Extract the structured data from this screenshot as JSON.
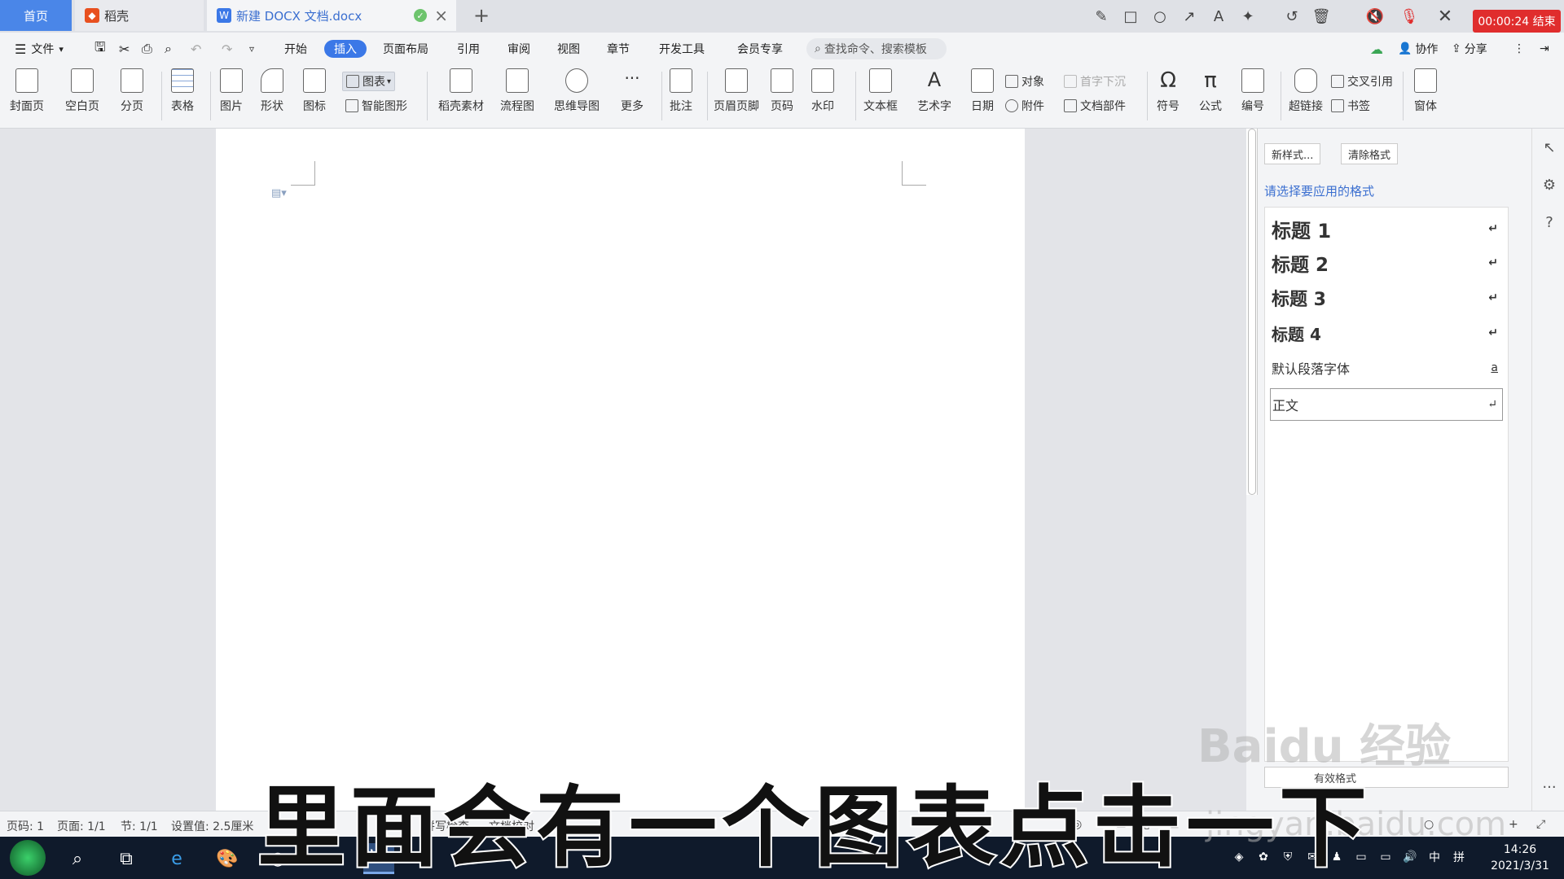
{
  "tabs": {
    "home": "首页",
    "daoke": "稻壳",
    "document": "新建 DOCX 文档.docx",
    "add": "+"
  },
  "recording": {
    "badge": "00:00:24 结束"
  },
  "menu": {
    "file": "文件",
    "items": [
      "开始",
      "插入",
      "页面布局",
      "引用",
      "审阅",
      "视图",
      "章节",
      "开发工具",
      "会员专享"
    ],
    "active": "插入",
    "search_placeholder": "查找命令、搜索模板",
    "collaborate": "协作",
    "share": "分享"
  },
  "ribbon": {
    "cover": "封面页",
    "blank": "空白页",
    "pagebreak": "分页",
    "table": "表格",
    "picture": "图片",
    "shape": "形状",
    "icon": "图标",
    "chart": "图表",
    "smartart": "智能图形",
    "daoke_material": "稻壳素材",
    "flowchart": "流程图",
    "mindmap": "思维导图",
    "more": "更多",
    "comment": "批注",
    "header_footer": "页眉页脚",
    "page_number": "页码",
    "watermark": "水印",
    "textbox": "文本框",
    "wordart": "艺术字",
    "date": "日期",
    "object": "对象",
    "attachment": "附件",
    "dropcap": "首字下沉",
    "doc_parts": "文档部件",
    "symbol": "符号",
    "formula": "公式",
    "numbering": "编号",
    "hyperlink": "超链接",
    "cross_ref": "交叉引用",
    "bookmark": "书签",
    "form": "窗体"
  },
  "pane": {
    "new_style": "新样式...",
    "clear_format": "清除格式",
    "prompt": "请选择要应用的格式",
    "styles": [
      {
        "label": "标题 1",
        "mark": "↵"
      },
      {
        "label": "标题 2",
        "mark": "↵"
      },
      {
        "label": "标题 3",
        "mark": "↵"
      },
      {
        "label": "标题 4",
        "mark": "↵"
      },
      {
        "label": "默认段落字体",
        "mark": "a"
      },
      {
        "label": "正文",
        "mark": "↵"
      }
    ],
    "footer": "有效格式"
  },
  "status": {
    "page": "页码: 1",
    "pages": "页面: 1/1",
    "section": "节: 1/1",
    "setting": "设置值: 2.5厘米",
    "spell": "拼写检查",
    "doc_check": "文档校对"
  },
  "taskbar": {
    "time": "14:26",
    "date": "2021/3/31",
    "ime_cn": "中",
    "ime_pin": "拼"
  },
  "caption": "里面会有一个图表点击一下",
  "watermark": {
    "brand": "Baidu 经验",
    "url": "jingyan.baidu.com"
  }
}
